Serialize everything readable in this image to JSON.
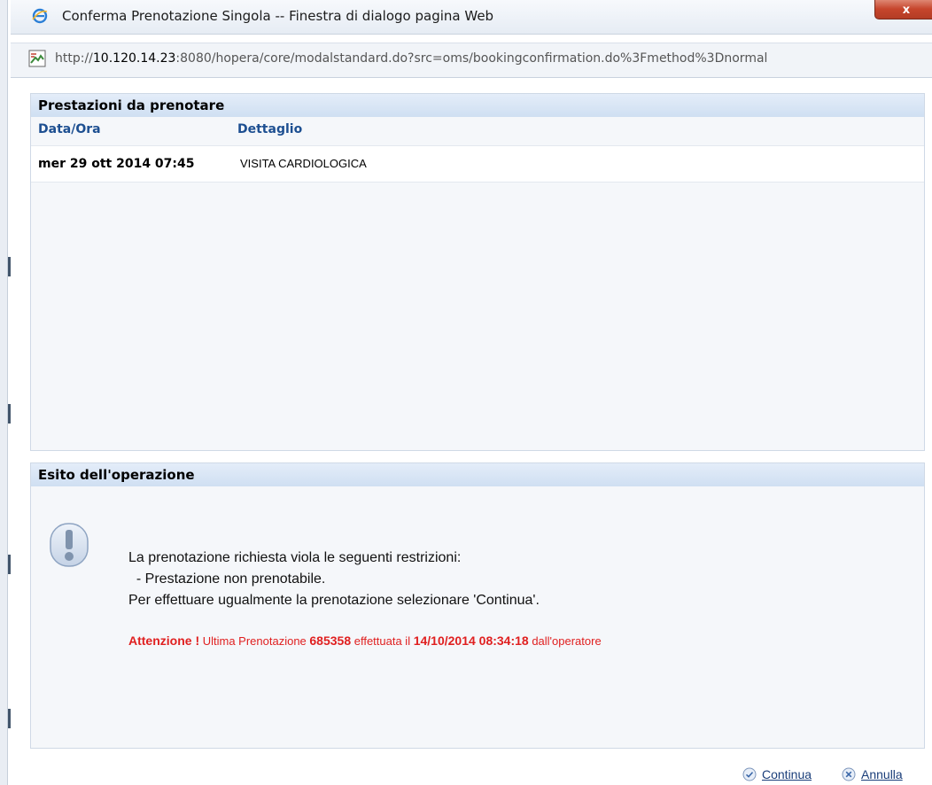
{
  "window": {
    "title": "Conferma Prenotazione Singola -- Finestra di dialogo pagina Web",
    "close_label": "x",
    "browser_icon": "internet-explorer-icon"
  },
  "address": {
    "prefix": "http://",
    "host": "10.120.14.23",
    "rest": ":8080/hopera/core/modalstandard.do?src=oms/bookingconfirmation.do%3Fmethod%3Dnormal",
    "page_icon": "broken-image-icon"
  },
  "bookings_panel": {
    "title": "Prestazioni da prenotare",
    "columns": [
      "Data/Ora",
      "Dettaglio"
    ],
    "rows": [
      {
        "date": "mer 29 ott 2014 07:45",
        "detail": "VISITA CARDIOLOGICA"
      }
    ]
  },
  "result_panel": {
    "title": "Esito dell'operazione",
    "icon": "warning-exclamation-icon",
    "lines": [
      "La prenotazione richiesta viola le seguenti restrizioni:",
      "  - Prestazione non prenotabile.",
      "Per effettuare ugualmente la prenotazione selezionare 'Continua'."
    ],
    "alert": {
      "prefix": "Attenzione !",
      "text1": " Ultima Prenotazione ",
      "booking_number": "685358",
      "text2": " effettuata il ",
      "datetime": "14/10/2014 08:34:18",
      "text3": " dall'operatore"
    },
    "alert_color": "#e02020"
  },
  "actions": {
    "continue_label": "Continua",
    "continue_icon": "check-circle-icon",
    "cancel_label": "Annulla",
    "cancel_icon": "x-circle-icon"
  },
  "colors": {
    "header_bg": "#cfdff2",
    "column_text": "#1d4f91",
    "link": "#1a3e7a"
  }
}
